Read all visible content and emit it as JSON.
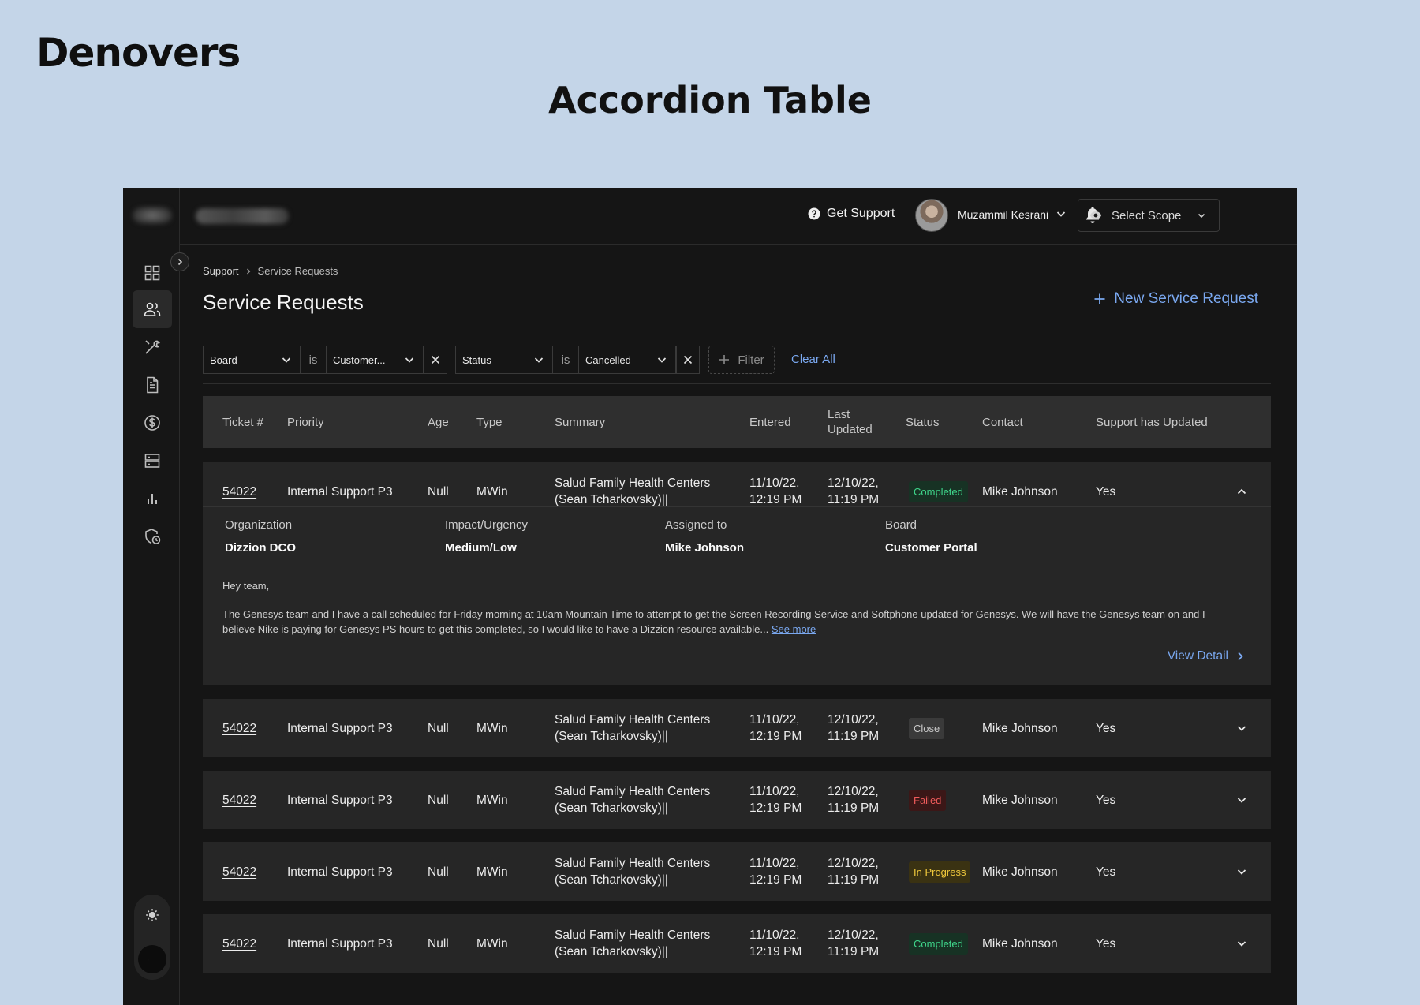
{
  "brand": "Denovers",
  "heading": "Accordion Table",
  "topbar": {
    "get_support": "Get Support",
    "user_name": "Muzammil Kesrani",
    "scope_label": "Select Scope"
  },
  "breadcrumb": {
    "parent": "Support",
    "current": "Service Requests"
  },
  "page": {
    "title": "Service Requests",
    "new_request": "New Service Request"
  },
  "filters": {
    "board_field": "Board",
    "board_op": "is",
    "board_value": "Customer...",
    "status_field": "Status",
    "status_op": "is",
    "status_value": "Cancelled",
    "add_filter": "Filter",
    "clear_all": "Clear All"
  },
  "table": {
    "headers": {
      "ticket": "Ticket #",
      "priority": "Priority",
      "age": "Age",
      "type": "Type",
      "summary": "Summary",
      "entered": "Entered",
      "last_updated_1": "Last",
      "last_updated_2": "Updated",
      "status": "Status",
      "contact": "Contact",
      "support_updated": "Support has Updated"
    },
    "rows": [
      {
        "ticket": "54022",
        "priority": "Internal Support P3",
        "age": "Null",
        "type": "MWin",
        "summary_1": "Salud Family Health Centers",
        "summary_2": "(Sean Tcharkovsky)||",
        "entered_1": "11/10/22,",
        "entered_2": "12:19 PM",
        "updated_1": "12/10/22,",
        "updated_2": "11:19 PM",
        "status": "Completed",
        "contact": "Mike Johnson",
        "support_updated": "Yes",
        "expanded": true
      },
      {
        "ticket": "54022",
        "priority": "Internal Support P3",
        "age": "Null",
        "type": "MWin",
        "summary_1": "Salud Family Health Centers",
        "summary_2": "(Sean Tcharkovsky)||",
        "entered_1": "11/10/22,",
        "entered_2": "12:19 PM",
        "updated_1": "12/10/22,",
        "updated_2": "11:19 PM",
        "status": "Close",
        "contact": "Mike Johnson",
        "support_updated": "Yes",
        "expanded": false
      },
      {
        "ticket": "54022",
        "priority": "Internal Support P3",
        "age": "Null",
        "type": "MWin",
        "summary_1": "Salud Family Health Centers",
        "summary_2": "(Sean Tcharkovsky)||",
        "entered_1": "11/10/22,",
        "entered_2": "12:19 PM",
        "updated_1": "12/10/22,",
        "updated_2": "11:19 PM",
        "status": "Failed",
        "contact": "Mike Johnson",
        "support_updated": "Yes",
        "expanded": false
      },
      {
        "ticket": "54022",
        "priority": "Internal Support P3",
        "age": "Null",
        "type": "MWin",
        "summary_1": "Salud Family Health Centers",
        "summary_2": "(Sean Tcharkovsky)||",
        "entered_1": "11/10/22,",
        "entered_2": "12:19 PM",
        "updated_1": "12/10/22,",
        "updated_2": "11:19 PM",
        "status": "In Progress",
        "contact": "Mike Johnson",
        "support_updated": "Yes",
        "expanded": false
      },
      {
        "ticket": "54022",
        "priority": "Internal Support P3",
        "age": "Null",
        "type": "MWin",
        "summary_1": "Salud Family Health Centers",
        "summary_2": "(Sean Tcharkovsky)||",
        "entered_1": "11/10/22,",
        "entered_2": "12:19 PM",
        "updated_1": "12/10/22,",
        "updated_2": "11:19 PM",
        "status": "Completed",
        "contact": "Mike Johnson",
        "support_updated": "Yes",
        "expanded": false
      }
    ]
  },
  "detail": {
    "organization_label": "Organization",
    "organization_value": "Dizzion DCO",
    "impact_label": "Impact/Urgency",
    "impact_value": "Medium/Low",
    "assigned_label": "Assigned to",
    "assigned_value": "Mike Johnson",
    "board_label": "Board",
    "board_value": "Customer Portal",
    "greeting": "Hey team,",
    "body": "The Genesys team and I have a call scheduled for Friday morning at 10am Mountain Time to attempt to get the Screen Recording Service and Softphone updated for Genesys. We will have the Genesys team on and I believe Nike is paying for Genesys PS hours to get this completed, so I would like to have a Dizzion resource available...",
    "see_more": "See more",
    "view_detail": "View Detail"
  },
  "colors": {
    "accent": "#7aa8f0",
    "completed": "#3fd68b",
    "failed": "#ef5b5b",
    "in_progress": "#f0c93c",
    "close": "#c9c9c9"
  },
  "icons": {
    "sidebar": [
      "dashboard-icon",
      "users-icon",
      "wrench-icon",
      "document-icon",
      "dollar-icon",
      "server-icon",
      "bar-chart-icon",
      "shield-clock-icon"
    ],
    "theme": [
      "sun-icon",
      "moon-icon"
    ]
  }
}
